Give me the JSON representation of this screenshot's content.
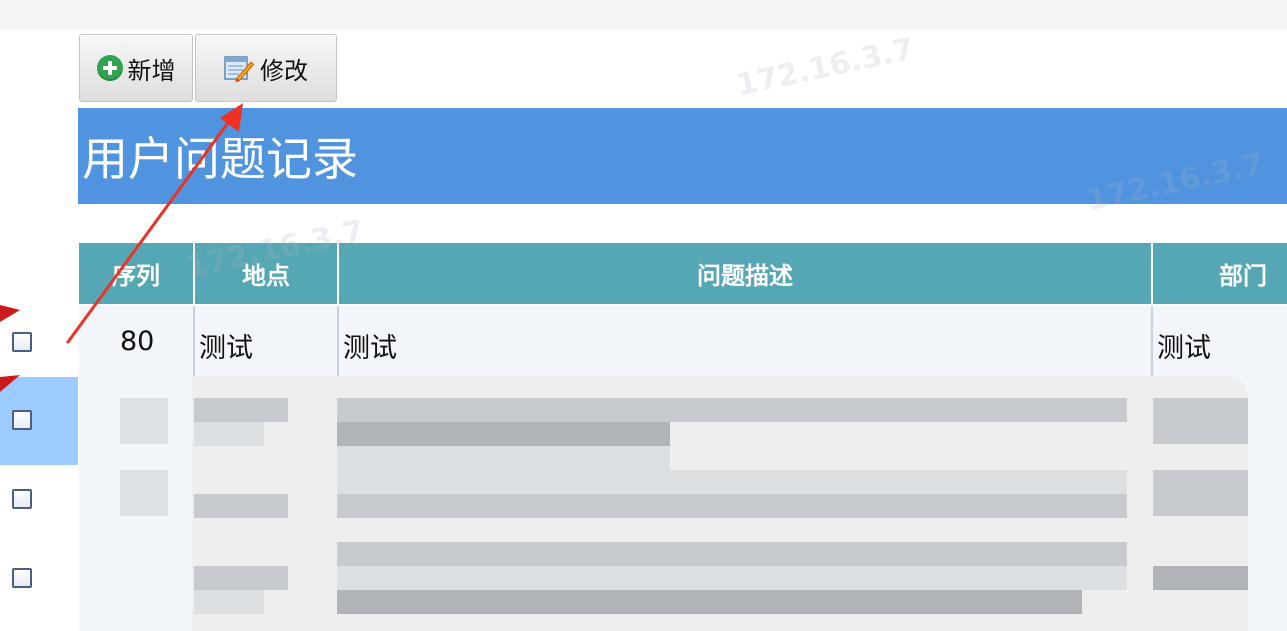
{
  "toolbar": {
    "add_label": "新增",
    "edit_label": "修改"
  },
  "page": {
    "title": "用户问题记录"
  },
  "table": {
    "headers": [
      "序列",
      "地点",
      "问题描述",
      "部门"
    ],
    "rows": [
      {
        "seq": "80",
        "location": "测试",
        "description": "测试",
        "department": "测试"
      }
    ]
  },
  "watermark_text": "172.16.3.7",
  "colors": {
    "title_bar": "#5094e0",
    "table_header": "#56a7b5",
    "selected_row": "#9ccbff",
    "annotation_arrow": "#ee3124"
  }
}
